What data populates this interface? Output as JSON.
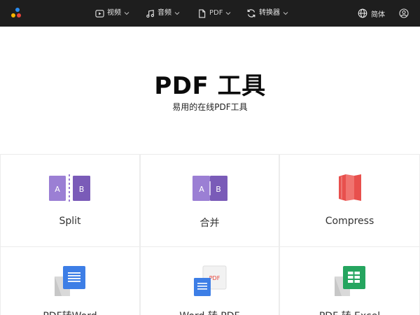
{
  "nav": {
    "items": [
      {
        "label": "视频",
        "icon": "video-icon"
      },
      {
        "label": "音频",
        "icon": "music-note-icon"
      },
      {
        "label": "PDF",
        "icon": "document-icon"
      },
      {
        "label": "转换器",
        "icon": "convert-icon"
      }
    ],
    "language": "简体",
    "language_icon": "globe-icon",
    "account_icon": "user-icon"
  },
  "hero": {
    "title": "PDF 工具",
    "subtitle": "易用的在线PDF工具"
  },
  "tools": [
    {
      "label": "Split",
      "icon": "split-pdf-icon",
      "icon_text": [
        "A",
        "B"
      ]
    },
    {
      "label": "合并",
      "icon": "merge-pdf-icon",
      "icon_text": [
        "A",
        "B"
      ]
    },
    {
      "label": "Compress",
      "icon": "compress-pdf-icon"
    },
    {
      "label": "PDF转Word",
      "icon": "pdf-to-word-icon"
    },
    {
      "label": "Word 转 PDF",
      "icon": "word-to-pdf-icon",
      "icon_text": "PDF"
    },
    {
      "label": "PDF 转 Excel",
      "icon": "pdf-to-excel-icon"
    }
  ],
  "colors": {
    "nav_bg": "#1e1e1e",
    "logo_dots": [
      "#2b8cf0",
      "#f7b500",
      "#e8443a"
    ],
    "split_purple": "#8a67c7",
    "compress_red": "#e8504d",
    "word_blue": "#3d7ee6",
    "excel_green": "#25a55f",
    "pdf_red": "#e8443a"
  }
}
